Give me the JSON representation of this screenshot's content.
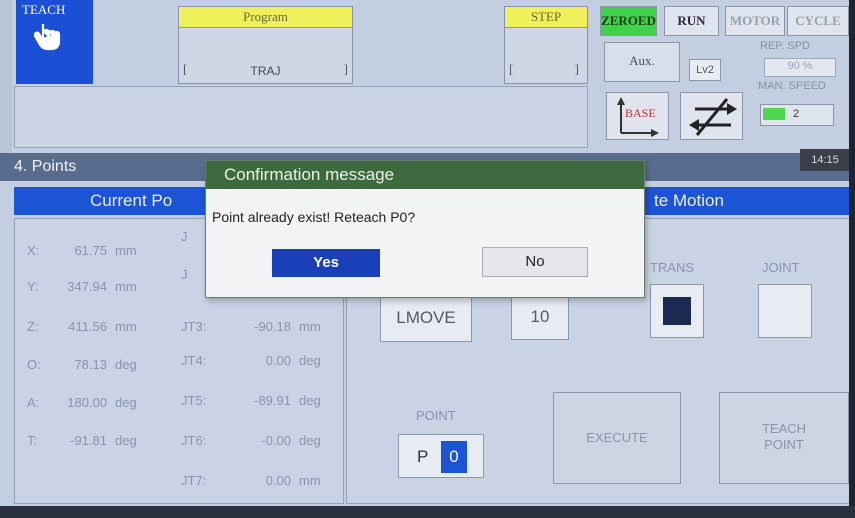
{
  "top": {
    "teach_label": "TEACH",
    "program_label": "Program",
    "program_value": "TRAJ",
    "step_label": "STEP",
    "bracket_open": "[",
    "bracket_close": "]",
    "zeroed": "ZEROED",
    "run": "RUN",
    "motor": "MOTOR",
    "cycle": "CYCLE",
    "aux": "Aux.",
    "level": "Lv2",
    "rep_spd_label": "REP. SPD",
    "rep_spd_value": "90 %",
    "man_spd_label": "MAN. SPEED",
    "man_spd_value": "2",
    "base_label": "BASE"
  },
  "screen": {
    "title": "4. Points",
    "clock": "14:15",
    "current_pos_header": "Current Po",
    "motion_header": "te Motion"
  },
  "positions": [
    {
      "axis": "X:",
      "value": "61.75",
      "unit": "mm"
    },
    {
      "axis": "Y:",
      "value": "347.94",
      "unit": "mm"
    },
    {
      "axis": "Z:",
      "value": "411.56",
      "unit": "mm"
    },
    {
      "axis": "O:",
      "value": "78.13",
      "unit": "deg"
    },
    {
      "axis": "A:",
      "value": "180.00",
      "unit": "deg"
    },
    {
      "axis": "T:",
      "value": "-91.81",
      "unit": "deg"
    }
  ],
  "joints": [
    {
      "label": "J",
      "value": "",
      "unit": ""
    },
    {
      "label": "J",
      "value": "",
      "unit": ""
    },
    {
      "label": "JT3:",
      "value": "-90.18",
      "unit": "mm"
    },
    {
      "label": "JT4:",
      "value": "0.00",
      "unit": "deg"
    },
    {
      "label": "JT5:",
      "value": "-89.91",
      "unit": "deg"
    },
    {
      "label": "JT6:",
      "value": "-0.00",
      "unit": "deg"
    },
    {
      "label": "JT7:",
      "value": "0.00",
      "unit": "mm"
    }
  ],
  "motion": {
    "lmove": "LMOVE",
    "speed": "10",
    "trans": "TRANS",
    "joint": "JOINT",
    "point_label": "POINT",
    "point_prefix": "P",
    "point_number": "0",
    "execute": "EXECUTE",
    "teach_point_line1": "TEACH",
    "teach_point_line2": "POINT"
  },
  "dialog": {
    "title": "Confirmation message",
    "message": "Point already exist! Reteach P0?",
    "yes": "Yes",
    "no": "No"
  }
}
